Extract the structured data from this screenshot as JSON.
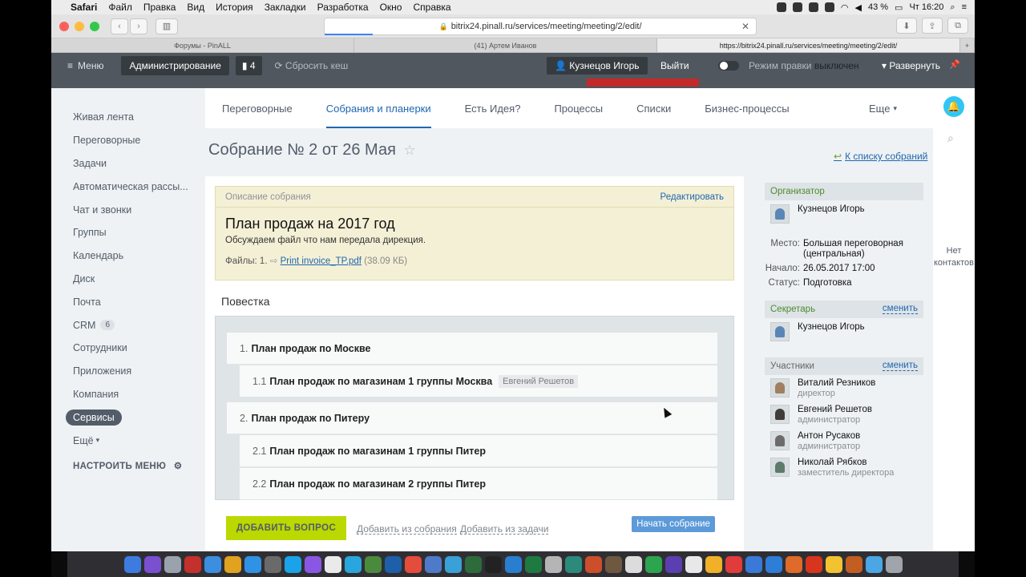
{
  "menubar": {
    "app": "Safari",
    "items": [
      "Файл",
      "Правка",
      "Вид",
      "История",
      "Закладки",
      "Разработка",
      "Окно",
      "Справка"
    ],
    "battery": "43 %",
    "clock": "Чт 16:20"
  },
  "browser": {
    "url": "bitrix24.pinall.ru/services/meeting/meeting/2/edit/",
    "tabs": [
      "Форумы - PinALL",
      "(41) Артем Иванов",
      "https://bitrix24.pinall.ru/services/meeting/meeting/2/edit/"
    ]
  },
  "panel": {
    "menu": "Меню",
    "admin": "Администрирование",
    "count": "4",
    "reset_cache": "Сбросить кеш",
    "user": "Кузнецов Игорь",
    "logout": "Выйти",
    "edit_mode_label": "Режим правки",
    "edit_mode_state": "выключен",
    "expand": "Развернуть"
  },
  "leftnav": {
    "items": [
      "Живая лента",
      "Переговорные",
      "Задачи",
      "Автоматическая рассы...",
      "Чат и звонки",
      "Группы",
      "Календарь",
      "Диск",
      "Почта",
      "CRM",
      "Сотрудники",
      "Приложения",
      "Компания",
      "Сервисы",
      "Ещё"
    ],
    "crm_badge": "6",
    "configure": "НАСТРОИТЬ МЕНЮ"
  },
  "topmenu": {
    "items": [
      "Переговорные",
      "Собрания и планерки",
      "Есть Идея?",
      "Процессы",
      "Списки",
      "Бизнес-процессы"
    ],
    "more": "Еще"
  },
  "rail": {
    "no_contacts": "Нет контактов"
  },
  "meeting": {
    "title": "Собрание № 2 от 26 Мая",
    "back_link": "К списку собраний",
    "description": {
      "header": "Описание собрания",
      "edit": "Редактировать",
      "title": "План продаж на 2017 год",
      "text": "Обсуждаем файл что нам передала дирекция.",
      "files_label": "Файлы: 1.",
      "file_name": "Print invoice_TP.pdf",
      "file_size": "(38.09 КБ)"
    },
    "agenda_title": "Повестка",
    "agenda": [
      {
        "num": "1.",
        "title": "План продаж по Москве",
        "tag": ""
      },
      {
        "num": "1.1",
        "title": "План продаж по магазинам 1 группы Москва",
        "tag": "Евгений Решетов"
      },
      {
        "num": "2.",
        "title": "План продаж по Питеру",
        "tag": ""
      },
      {
        "num": "2.1",
        "title": "План продаж по магазинам 1 группы Питер",
        "tag": ""
      },
      {
        "num": "2.2",
        "title": "План продаж по магазинам 2 группы Питер",
        "tag": ""
      }
    ],
    "add_question": "ДОБАВИТЬ ВОПРОС",
    "add_from_meeting": "Добавить из собрания",
    "add_from_task": "Добавить из задачи",
    "start_meeting": "Начать собрание"
  },
  "sidebar": {
    "organizer_label": "Организатор",
    "organizer": "Кузнецов Игорь",
    "place_label": "Место:",
    "place": "Большая переговорная (центральная)",
    "start_label": "Начало:",
    "start": "26.05.2017 17:00",
    "status_label": "Статус:",
    "status": "Подготовка",
    "secretary_label": "Секретарь",
    "secretary": "Кузнецов Игорь",
    "change": "сменить",
    "participants_label": "Участники",
    "participants": [
      {
        "name": "Виталий Резников",
        "role": "директор"
      },
      {
        "name": "Евгений Решетов",
        "role": "администратор"
      },
      {
        "name": "Антон Русаков",
        "role": "администратор"
      },
      {
        "name": "Николай Рябков",
        "role": "заместитель директора"
      }
    ]
  },
  "colors": {
    "accent": "#2067b0",
    "green_button": "#bbd800",
    "panel": "#50575f"
  }
}
